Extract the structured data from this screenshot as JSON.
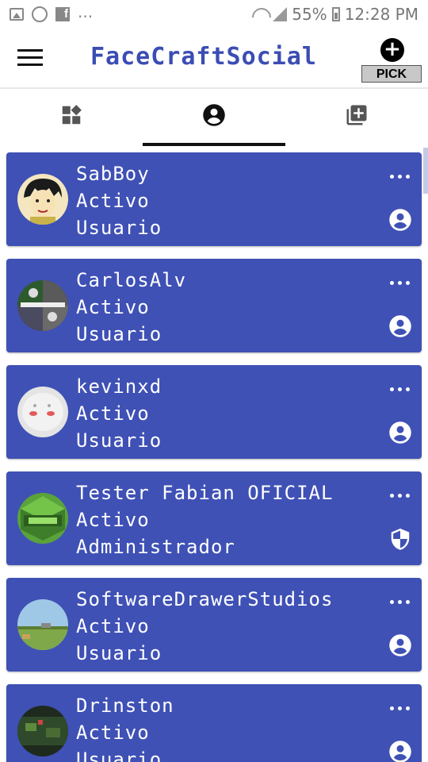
{
  "status_bar": {
    "left_icons": [
      "image-icon",
      "whatsapp-icon",
      "facebook-icon"
    ],
    "overflow": "...",
    "battery": "55%",
    "time": "12:28 PM"
  },
  "app_bar": {
    "title": "FaceCraftSocial",
    "pick_label": "PICK"
  },
  "tabs": [
    {
      "icon": "widgets-icon",
      "active": false
    },
    {
      "icon": "account-circle-icon",
      "active": true
    },
    {
      "icon": "add-to-library-icon",
      "active": false
    }
  ],
  "colors": {
    "card": "#3f51b5",
    "title": "#3b4db4"
  },
  "users": [
    {
      "name": "SabBoy",
      "status": "Activo",
      "role": "Usuario",
      "role_icon": "user-icon"
    },
    {
      "name": "CarlosAlv",
      "status": "Activo",
      "role": "Usuario",
      "role_icon": "user-icon"
    },
    {
      "name": "kevinxd",
      "status": "Activo",
      "role": "Usuario",
      "role_icon": "user-icon"
    },
    {
      "name": "Tester Fabian OFICIAL",
      "status": "Activo",
      "role": "Administrador",
      "role_icon": "shield-icon"
    },
    {
      "name": "SoftwareDrawerStudios",
      "status": "Activo",
      "role": "Usuario",
      "role_icon": "user-icon"
    },
    {
      "name": "Drinston",
      "status": "Activo",
      "role": "Usuario",
      "role_icon": "user-icon"
    }
  ]
}
